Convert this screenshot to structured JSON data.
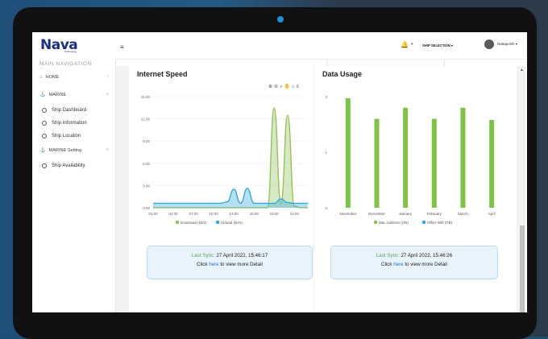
{
  "sidebar": {
    "logo": "Nava",
    "logo_sub": "Technology",
    "nav_header": "MAIN NAVIGATION",
    "items": [
      {
        "label": "HOME"
      },
      {
        "label": "MARINE"
      },
      {
        "label": "MARINE Setting"
      }
    ],
    "marine_sub": [
      "Ship Dashboard",
      "Ship Information",
      "Ship Location"
    ],
    "setting_sub": [
      "Ship Availability"
    ]
  },
  "topbar": {
    "ship_selection": "SHIP SELECTION",
    "username": "Nattapolsh"
  },
  "internet_speed": {
    "title": "Internet Speed",
    "sync_label": "Last Sync:",
    "sync_time": "27 April 2022, 15:46:17",
    "click": "Click",
    "here": "here",
    "rest": "to view more Detail"
  },
  "data_usage": {
    "title": "Data Usage",
    "sync_label": "Last Sync:",
    "sync_time": "27 April 2022, 15:46:26",
    "click": "Click",
    "here": "here",
    "rest": "to view more Detail"
  },
  "chart_data": [
    {
      "type": "area",
      "title": "Internet Speed",
      "x": [
        "01:00",
        "04:00",
        "07:00",
        "10:00",
        "13:00",
        "16:00",
        "19:00",
        "22:00"
      ],
      "ylim": [
        0,
        15
      ],
      "yticks": [
        "0.00",
        "3.00",
        "6.00",
        "9.00",
        "12.00",
        "15.00"
      ],
      "series": [
        {
          "name": "Download (kb/s)",
          "color": "#8cc152",
          "x": [
            0,
            1,
            2,
            3,
            4,
            5,
            6,
            7,
            8,
            9,
            10,
            11,
            12,
            13,
            14,
            15,
            16,
            17,
            18,
            19,
            20,
            21,
            22,
            23
          ],
          "values": [
            0,
            0,
            0,
            0,
            0,
            0,
            0,
            0,
            0,
            0,
            0,
            0,
            0,
            0,
            0,
            0,
            0,
            0,
            13.5,
            0.5,
            12.5,
            0.2,
            0,
            0
          ]
        },
        {
          "name": "Upload (kb/s)",
          "color": "#2aa7e0",
          "x": [
            0,
            1,
            2,
            3,
            4,
            5,
            6,
            7,
            8,
            9,
            10,
            11,
            12,
            13,
            14,
            15,
            16,
            17,
            18,
            19,
            20,
            21,
            22,
            23
          ],
          "values": [
            0.6,
            0.6,
            0.6,
            0.6,
            0.6,
            0.6,
            0.6,
            0.6,
            0.6,
            0.6,
            0.6,
            0.8,
            2.5,
            0.6,
            2.6,
            0.6,
            0.6,
            0.6,
            0.6,
            1.2,
            0.7,
            0.6,
            0.6,
            0.6
          ]
        }
      ]
    },
    {
      "type": "bar",
      "title": "Data Usage",
      "categories": [
        "November",
        "December",
        "January",
        "February",
        "March",
        "April"
      ],
      "ylim": [
        0,
        2
      ],
      "yticks": [
        "0",
        "1",
        "2"
      ],
      "series": [
        {
          "name": "Mac Address (GB)",
          "color": "#7cc243",
          "values": [
            1.97,
            1.6,
            1.8,
            1.6,
            1.8,
            1.58
          ]
        },
        {
          "name": "Office Wifi (GB)",
          "color": "#2aa7e0",
          "values": [
            0,
            0,
            0,
            0,
            0,
            0
          ]
        }
      ]
    }
  ]
}
